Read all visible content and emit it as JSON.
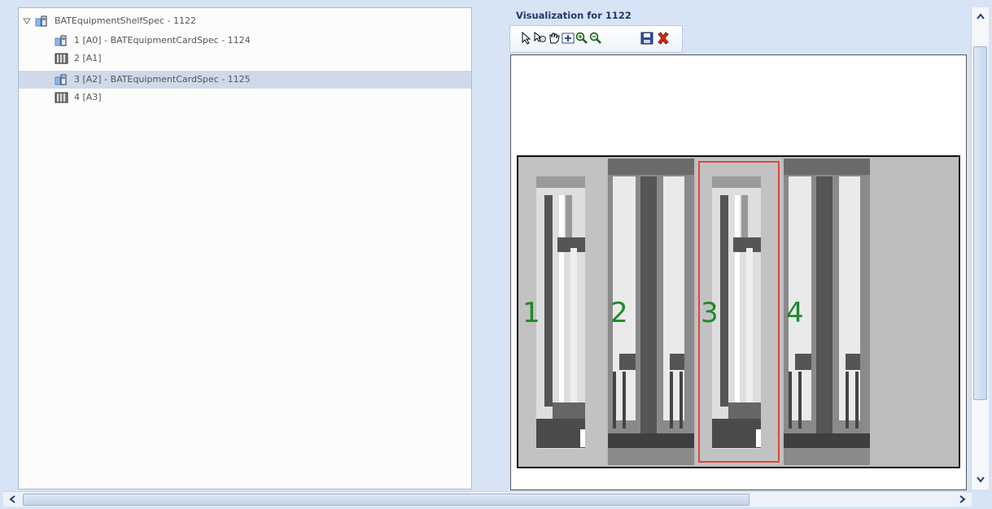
{
  "tree": {
    "root": {
      "label": "BATEquipmentShelfSpec - 1122",
      "icon": "shelf-spec-icon",
      "expander": "▽"
    },
    "items": [
      {
        "label": "1 [A0] - BATEquipmentCardSpec - 1124",
        "icon": "card-spec-icon",
        "selected": false
      },
      {
        "label": "2 [A1]",
        "icon": "slot-icon",
        "selected": false
      },
      {
        "label": "3 [A2] - BATEquipmentCardSpec - 1125",
        "icon": "card-spec-icon",
        "selected": true
      },
      {
        "label": "4 [A3]",
        "icon": "slot-icon",
        "selected": false
      }
    ]
  },
  "visualization": {
    "title": "Visualization for 1122",
    "toolbar": [
      {
        "name": "select-pointer-icon",
        "glyph": "↖"
      },
      {
        "name": "select-zoom-icon",
        "glyph": "⌕"
      },
      {
        "name": "pan-hand-icon",
        "glyph": "✋"
      },
      {
        "name": "fit-to-window-icon",
        "glyph": "⊞"
      },
      {
        "name": "zoom-in-icon",
        "glyph": "🔍"
      },
      {
        "name": "zoom-out-icon",
        "glyph": "🔍"
      },
      {
        "name": "save-icon",
        "glyph": "▣"
      },
      {
        "name": "delete-icon",
        "glyph": "✖"
      }
    ],
    "slots": [
      {
        "label": "1",
        "has_card": true,
        "selected": false
      },
      {
        "label": "2",
        "has_card": false,
        "selected": false
      },
      {
        "label": "3",
        "has_card": true,
        "selected": true
      },
      {
        "label": "4",
        "has_card": false,
        "selected": false
      },
      {
        "label": "",
        "has_card": false,
        "empty": true,
        "selected": false
      }
    ]
  },
  "colors": {
    "slot_label": "#1c8a2a",
    "selection_border": "#e0453a",
    "tree_selected": "#cfd9ea",
    "title": "#22386a"
  }
}
